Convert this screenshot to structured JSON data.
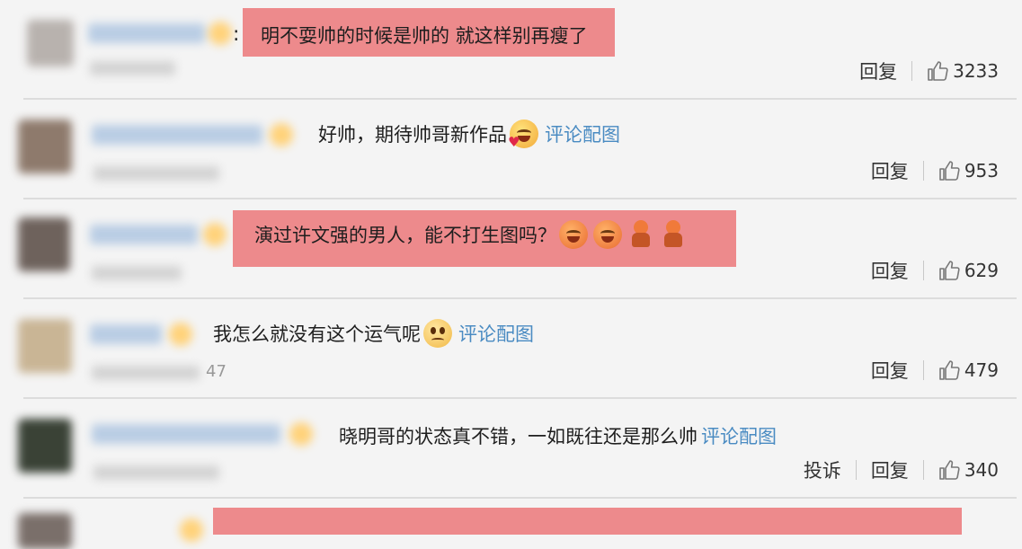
{
  "comments": [
    {
      "text": "明不耍帅的时候是帅的 就这样别再瘦了",
      "has_colon": true,
      "highlighted": true,
      "emojis": [],
      "link": "",
      "actions": [
        "回复"
      ],
      "likes": "3233"
    },
    {
      "text": "好帅，期待帅哥新作品",
      "has_colon": false,
      "highlighted": false,
      "emojis": [
        "smile-blush-emoji"
      ],
      "link": "评论配图",
      "actions": [
        "回复"
      ],
      "likes": "953"
    },
    {
      "text": "演过许文强的男人，能不打生图吗？",
      "has_colon": false,
      "highlighted": true,
      "emojis": [
        "laugh-cry-emoji",
        "laugh-cry-emoji",
        "doll-figure-emoji",
        "doll-figure-emoji"
      ],
      "link": "",
      "actions": [
        "回复"
      ],
      "likes": "629"
    },
    {
      "text": "我怎么就没有这个运气呢",
      "has_colon": false,
      "highlighted": false,
      "emojis": [
        "pleading-emoji"
      ],
      "link": "评论配图",
      "actions": [
        "回复"
      ],
      "likes": "479",
      "partial_time": "47"
    },
    {
      "text": "晓明哥的状态真不错，一如既往还是那么帅",
      "has_colon": false,
      "highlighted": false,
      "emojis": [],
      "link": "评论配图",
      "actions": [
        "投诉",
        "回复"
      ],
      "likes": "340"
    },
    {
      "text": "",
      "has_colon": false,
      "highlighted": true,
      "emojis": [],
      "link": "",
      "actions": [],
      "likes": ""
    }
  ],
  "colors": {
    "background": "#f4f4f4",
    "highlight": "#ed8a8c",
    "link": "#4a8bc2",
    "divider": "#dcdcdc"
  }
}
